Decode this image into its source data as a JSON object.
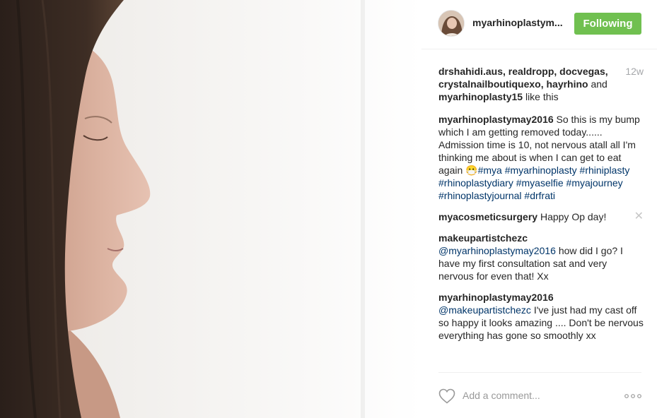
{
  "post": {
    "username": "myarhinoplastym...",
    "follow_label": "Following",
    "timestamp": "12w",
    "likes": {
      "names": "drshahidi.aus, realdropp, docvegas, crystalnailboutiquexo, hayrhino",
      "and": " and ",
      "last_name": "myarhinoplasty15",
      "suffix": " like this"
    },
    "caption": {
      "user": "myarhinoplastymay2016",
      "text": " So this is my bump which I am getting removed today...... Admission time is 10, not nervous atall all I'm thinking me about is when I can get to eat again 😷",
      "tags": "#mya #myarhinoplasty #rhiniplasty #rhinoplastydiary #myaselfie #myajourney #rhinoplastyjournal #drfrati"
    },
    "comments": [
      {
        "user": "myacosmeticsurgery",
        "mention": "",
        "text": " Happy Op day!"
      },
      {
        "user": "makeupartistchezc",
        "mention": " @myarhinoplastymay2016",
        "text": " how did I go? I have my first consultation sat and very nervous for even that! Xx"
      },
      {
        "user": "myarhinoplastymay2016",
        "mention": " @makeupartistchezc",
        "text": " I've just had my cast off so happy it looks amazing .... Don't be nervous everything has gone so smoothly xx"
      }
    ],
    "remove_icon": "✕",
    "add_comment_placeholder": "Add a comment..."
  },
  "icons": {
    "heart": "heart-outline-icon",
    "more": "more-options-icon",
    "remove": "close-icon"
  },
  "colors": {
    "follow_bg": "#70c050",
    "hashtag": "#003569",
    "muted": "#a5a7aa"
  }
}
